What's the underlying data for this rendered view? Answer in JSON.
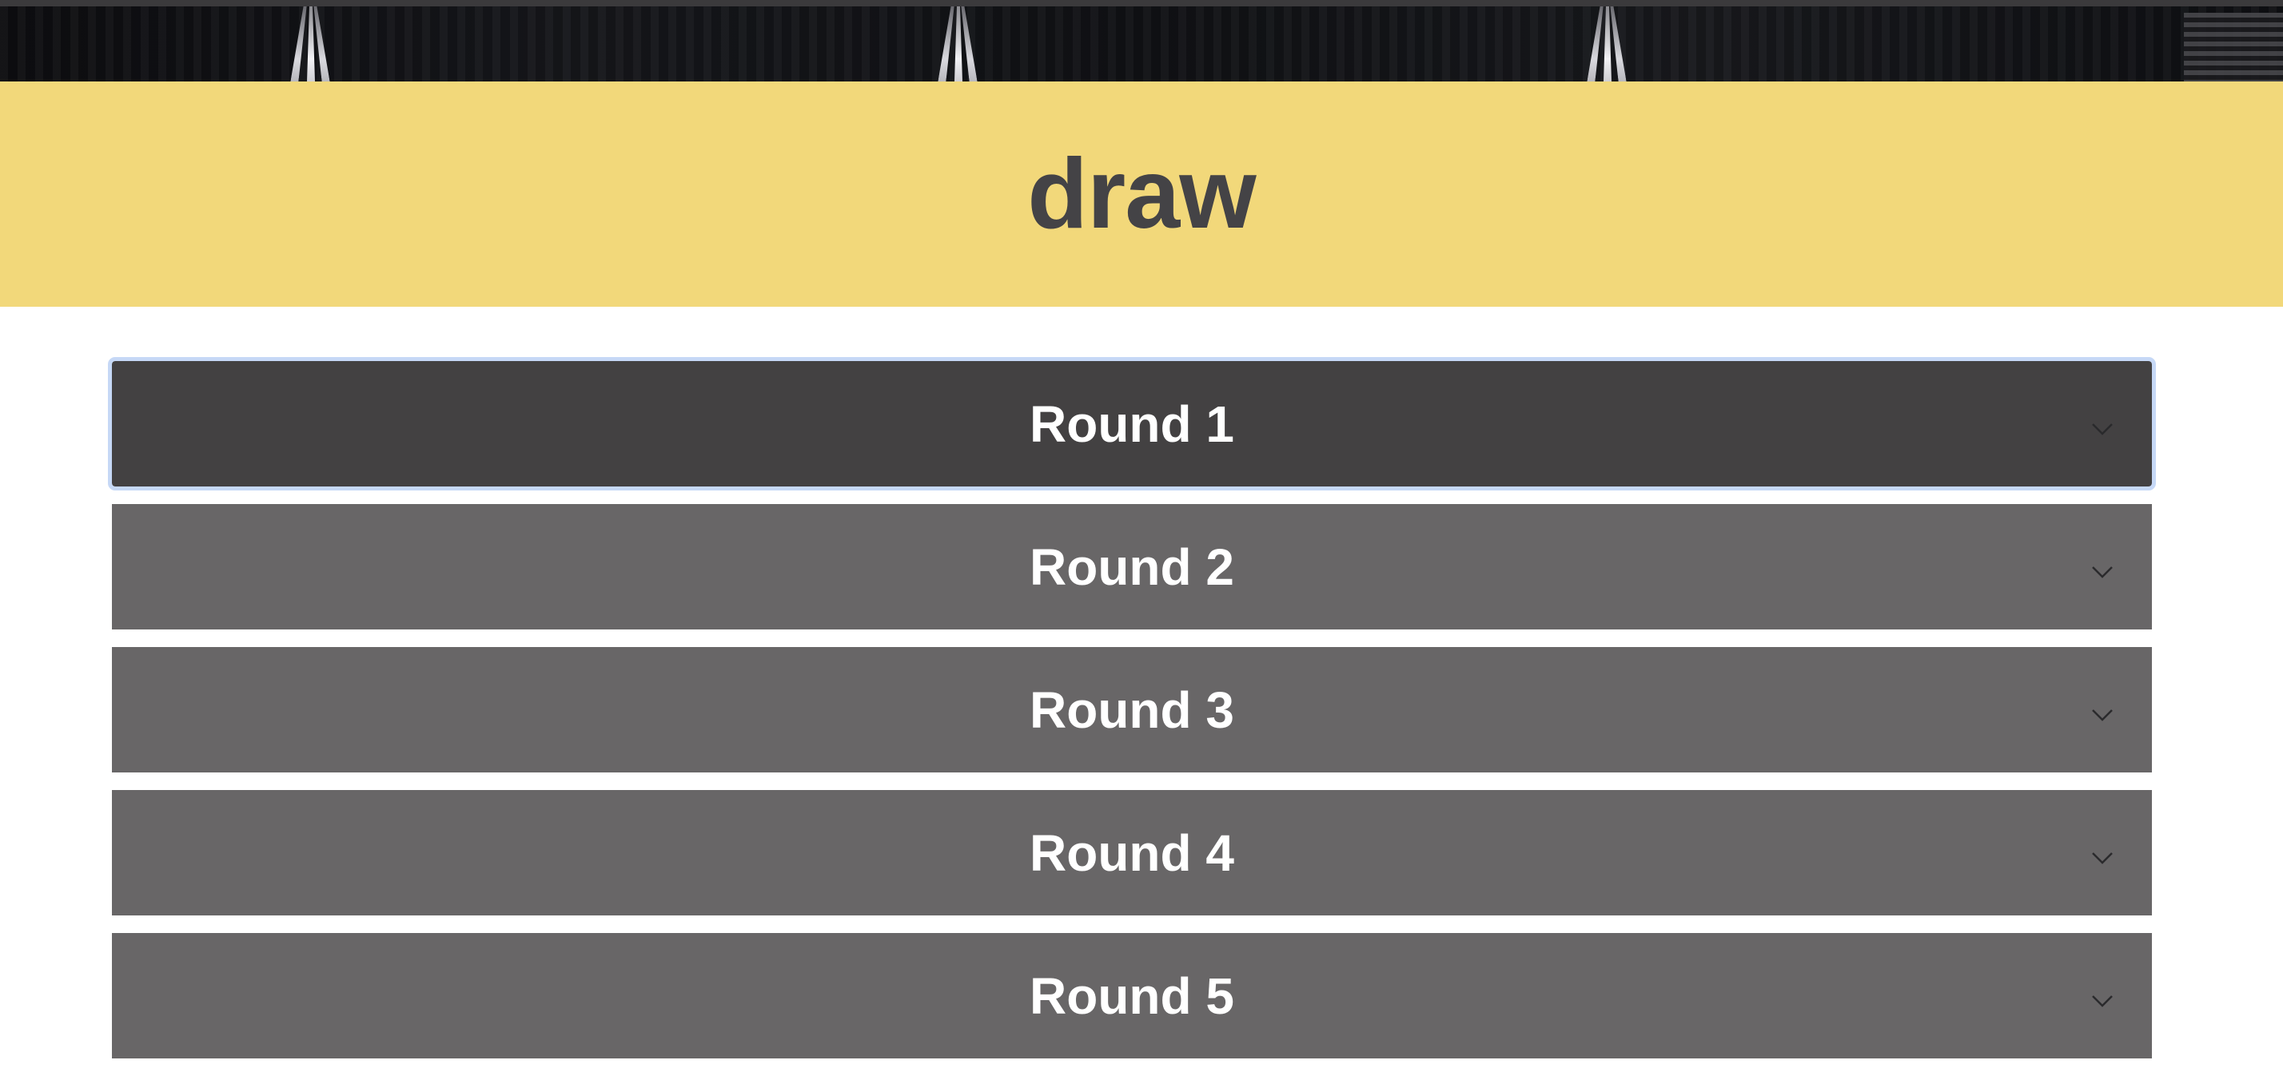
{
  "page": {
    "title": "draw"
  },
  "colors": {
    "banner": "#f2d87a",
    "title_text": "#444346",
    "round_active": "#434142",
    "round_inactive": "#686667",
    "focus_ring": "#c6d8f6"
  },
  "rounds": [
    {
      "label": "Round 1",
      "icon": "chevron-down-icon",
      "expanded": false,
      "focused": true
    },
    {
      "label": "Round 2",
      "icon": "chevron-down-icon",
      "expanded": false,
      "focused": false
    },
    {
      "label": "Round 3",
      "icon": "chevron-down-icon",
      "expanded": false,
      "focused": false
    },
    {
      "label": "Round 4",
      "icon": "chevron-down-icon",
      "expanded": false,
      "focused": false
    },
    {
      "label": "Round 5",
      "icon": "chevron-down-icon",
      "expanded": false,
      "focused": false
    }
  ]
}
